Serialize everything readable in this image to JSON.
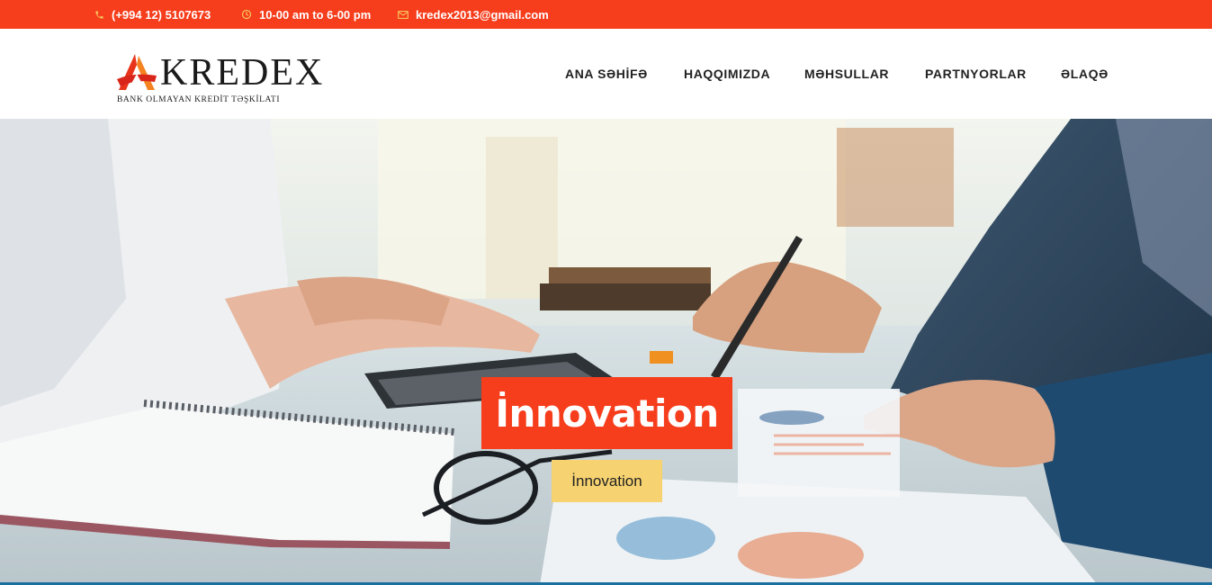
{
  "topbar": {
    "phone": "(+994 12) 5107673",
    "hours": "10-00 am to 6-00 pm",
    "email": "kredex2013@gmail.com",
    "icons": [
      "phone-icon",
      "clock-icon",
      "envelope-icon"
    ],
    "background_color": "#f63d1c",
    "icon_color": "#f7c35a"
  },
  "header": {
    "logo": {
      "name": "KREDEX",
      "subtitle": "BANK OLMAYAN KREDİT TƏŞKİLATI"
    },
    "nav": [
      {
        "label": "ANA SƏHİFƏ"
      },
      {
        "label": "HAQQIMIZDA"
      },
      {
        "label": "MƏHSULLAR"
      },
      {
        "label": "PARTNYORLAR"
      },
      {
        "label": "ƏLAQƏ"
      }
    ]
  },
  "hero": {
    "title": "İnnovation",
    "button_label": "İnnovation",
    "title_bg_color": "#f63d1c",
    "button_bg_color": "#f6d270"
  }
}
